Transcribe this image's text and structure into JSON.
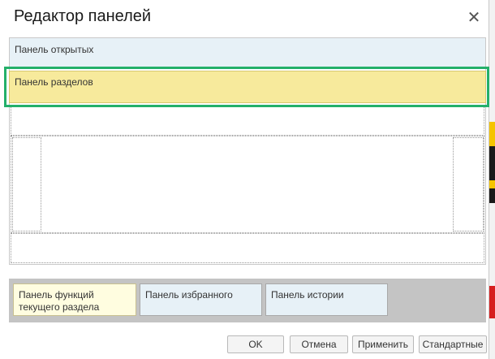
{
  "dialog": {
    "title": "Редактор панелей",
    "close_icon": "close-icon"
  },
  "editor": {
    "panel_open_label": "Панель открытых",
    "panel_sections_label": "Панель разделов",
    "selection_color": "#24b06a"
  },
  "bottom_panels": [
    {
      "label": "Панель функций текущего раздела"
    },
    {
      "label": "Панель избранного"
    },
    {
      "label": "Панель истории"
    }
  ],
  "buttons": {
    "ok": "OK",
    "cancel": "Отмена",
    "apply": "Применить",
    "standard": "Стандартные"
  }
}
